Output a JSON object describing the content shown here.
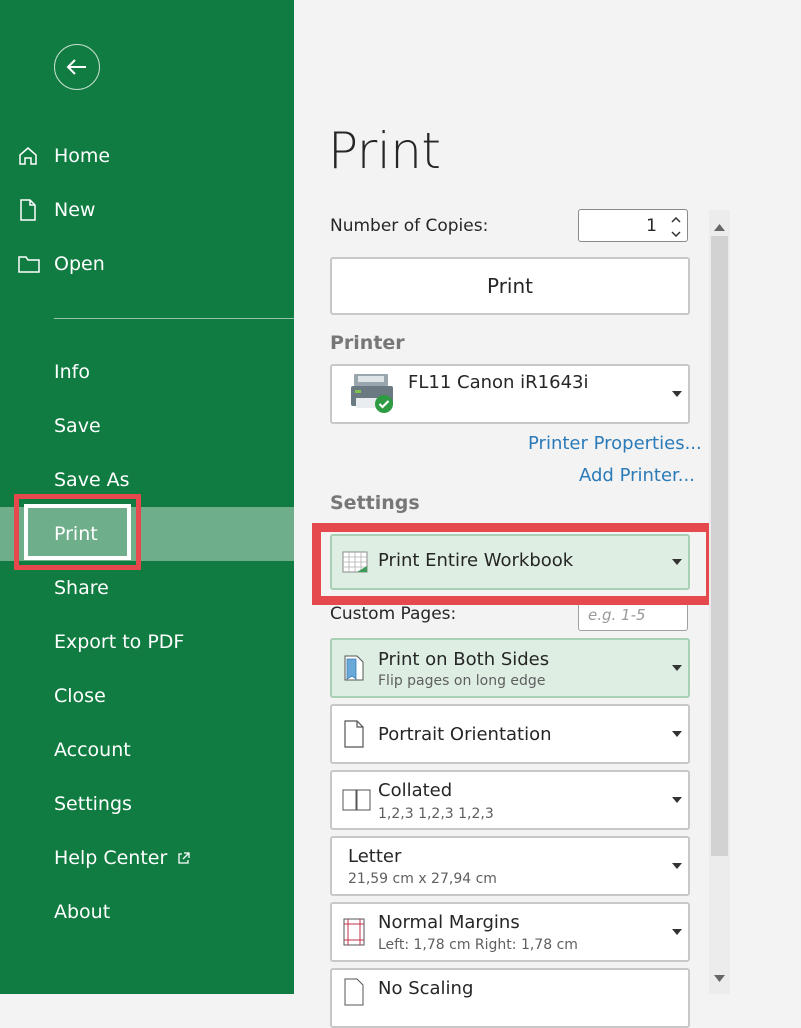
{
  "sidebar": {
    "top_items": [
      {
        "label": "Home",
        "icon": "home-icon"
      },
      {
        "label": "New",
        "icon": "new-document-icon"
      },
      {
        "label": "Open",
        "icon": "folder-icon"
      }
    ],
    "items": [
      "Info",
      "Save",
      "Save As",
      "Print",
      "Share",
      "Export to PDF",
      "Close",
      "Account",
      "Settings",
      "Help Center",
      "About"
    ],
    "active_item": "Print"
  },
  "main": {
    "title": "Print",
    "copies_label": "Number of Copies:",
    "copies_value": "1",
    "print_button": "Print",
    "printer_section": "Printer",
    "printer_name": "FL11 Canon iR1643i",
    "printer_properties_link": "Printer Properties...",
    "add_printer_link": "Add Printer...",
    "settings_section": "Settings",
    "print_what": "Print Entire Workbook",
    "custom_pages_label": "Custom Pages:",
    "custom_pages_placeholder": "e.g. 1-5",
    "sides": {
      "title": "Print on Both Sides",
      "subtitle": "Flip pages on long edge"
    },
    "orientation": "Portrait Orientation",
    "collation": {
      "title": "Collated",
      "subtitle": "1,2,3   1,2,3   1,2,3"
    },
    "paper": {
      "title": "Letter",
      "subtitle": "21,59 cm x 27,94 cm"
    },
    "margins": {
      "title": "Normal Margins",
      "subtitle": "Left:  1,78 cm   Right:  1,78 cm"
    },
    "scaling": "No Scaling"
  },
  "colors": {
    "sidebar_bg": "#107c41",
    "active_bg": "#6fae8b",
    "highlight": "#e5484d",
    "link": "#2b7bb9",
    "selected_dropdown": "#deeee3"
  }
}
